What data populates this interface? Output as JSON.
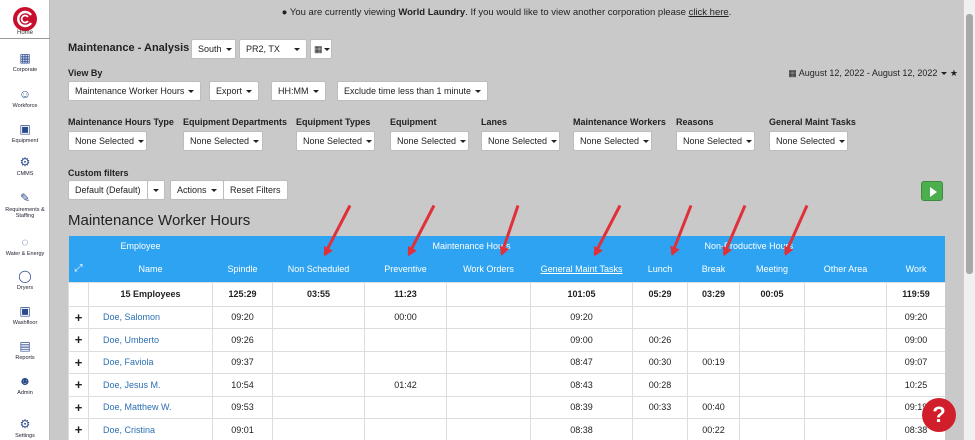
{
  "sidebar": {
    "home": "Home",
    "items": [
      {
        "label": "Corporate",
        "icon": "building-icon"
      },
      {
        "label": "Workforce",
        "icon": "users-icon"
      },
      {
        "label": "Equipment",
        "icon": "equipment-icon"
      },
      {
        "label": "CMMS",
        "icon": "search-gear-icon"
      },
      {
        "label": "Requirements & Staffing",
        "icon": "clipboard-icon"
      },
      {
        "label": "Water & Energy",
        "icon": "water-drop-icon"
      },
      {
        "label": "Dryers",
        "icon": "dryer-icon"
      },
      {
        "label": "Washfloor",
        "icon": "washer-icon"
      },
      {
        "label": "Reports",
        "icon": "report-icon"
      },
      {
        "label": "Admin",
        "icon": "admin-user-icon"
      },
      {
        "label": "Settings",
        "icon": "gear-icon"
      }
    ]
  },
  "notice": {
    "prefix": "You are currently viewing",
    "corp": "World Laundry",
    "middle": ". If you would like to view another corporation please",
    "link": "click here",
    "suffix": "."
  },
  "page": {
    "title": "Maintenance - Analysis",
    "region": "South",
    "location": "PR2, TX"
  },
  "viewby": {
    "label": "View By",
    "mode": "Maintenance Worker Hours",
    "export": "Export",
    "format": "HH:MM",
    "exclude": "Exclude time less than 1 minute"
  },
  "date_range": "August 12, 2022 - August 12, 2022",
  "filters": [
    {
      "label": "Maintenance Hours Type",
      "value": "None Selected"
    },
    {
      "label": "Equipment Departments",
      "value": "None Selected"
    },
    {
      "label": "Equipment Types",
      "value": "None Selected"
    },
    {
      "label": "Equipment",
      "value": "None Selected"
    },
    {
      "label": "Lanes",
      "value": "None Selected"
    },
    {
      "label": "Maintenance Workers",
      "value": "None Selected"
    },
    {
      "label": "Reasons",
      "value": "None Selected"
    },
    {
      "label": "General Maint Tasks",
      "value": "None Selected"
    }
  ],
  "custom": {
    "label": "Custom filters",
    "default": "Default (Default)",
    "actions": "Actions",
    "reset": "Reset Filters"
  },
  "section_title": "Maintenance Worker Hours",
  "table": {
    "groups": {
      "employee": "Employee",
      "maintenance": "Maintenance Hours",
      "nonproductive": "Non-Productive Hours"
    },
    "columns": [
      "Name",
      "Spindle",
      "Non Scheduled",
      "Preventive",
      "Work Orders",
      "General Maint Tasks",
      "Lunch",
      "Break",
      "Meeting",
      "Other Area",
      "Work"
    ],
    "total": {
      "label": "15 Employees",
      "values": [
        "125:29",
        "03:55",
        "11:23",
        "",
        "101:05",
        "05:29",
        "03:29",
        "00:05",
        "",
        "119:59"
      ]
    },
    "rows": [
      {
        "name": "Doe, Salomon",
        "values": [
          "09:20",
          "",
          "00:00",
          "",
          "09:20",
          "",
          "",
          "",
          "",
          "09:20"
        ]
      },
      {
        "name": "Doe, Umberto",
        "values": [
          "09:26",
          "",
          "",
          "",
          "09:00",
          "00:26",
          "",
          "",
          "",
          "09:00"
        ]
      },
      {
        "name": "Doe, Faviola",
        "values": [
          "09:37",
          "",
          "",
          "",
          "08:47",
          "00:30",
          "00:19",
          "",
          "",
          "09:07"
        ]
      },
      {
        "name": "Doe, Jesus M.",
        "values": [
          "10:54",
          "",
          "01:42",
          "",
          "08:43",
          "00:28",
          "",
          "",
          "",
          "10:25"
        ]
      },
      {
        "name": "Doe, Matthew W.",
        "values": [
          "09:53",
          "",
          "",
          "",
          "08:39",
          "00:33",
          "00:40",
          "",
          "",
          "09:19"
        ]
      },
      {
        "name": "Doe, Cristina",
        "values": [
          "09:01",
          "",
          "",
          "",
          "08:38",
          "",
          "00:22",
          "",
          "",
          "08:38"
        ]
      }
    ]
  },
  "help": "?"
}
